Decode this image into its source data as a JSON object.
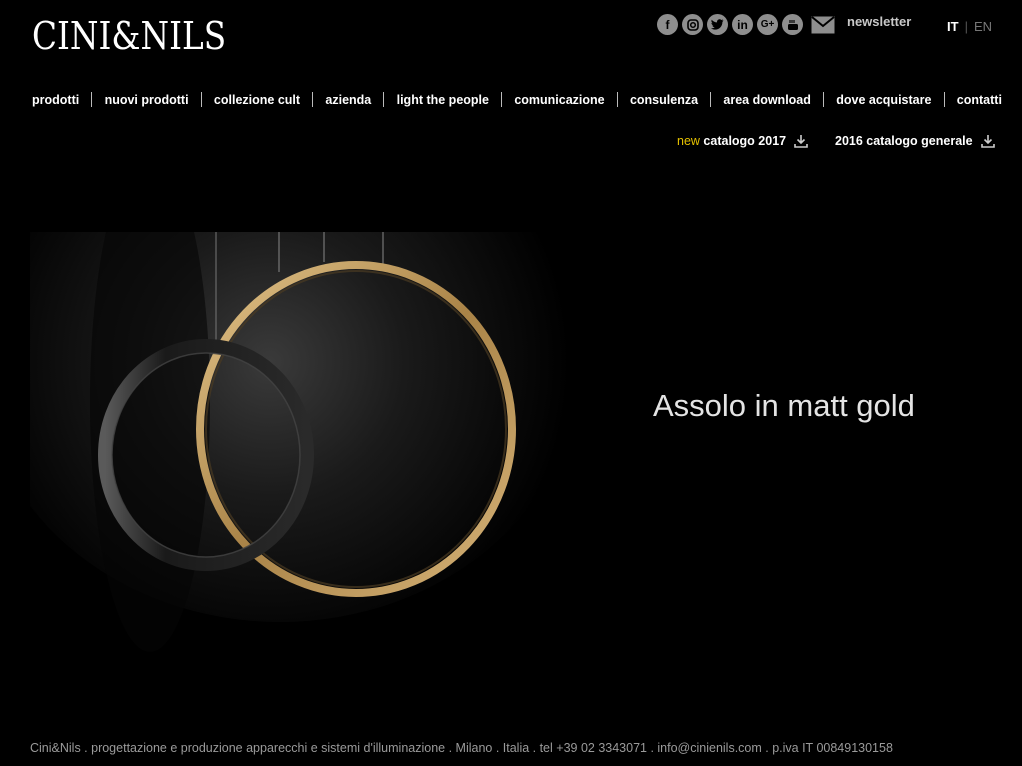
{
  "header": {
    "logo_text": "CINI&NILS",
    "social": [
      {
        "icon": "facebook-icon",
        "glyph": "f"
      },
      {
        "icon": "instagram-icon",
        "glyph": "◎"
      },
      {
        "icon": "twitter-icon",
        "glyph": "t"
      },
      {
        "icon": "linkedin-icon",
        "glyph": "in"
      },
      {
        "icon": "google-plus-icon",
        "glyph": "G+"
      },
      {
        "icon": "youtube-icon",
        "glyph": "▶"
      }
    ],
    "newsletter_label": "newsletter",
    "lang": {
      "it": "IT",
      "sep": "|",
      "en": "EN"
    }
  },
  "nav": {
    "items": [
      "prodotti",
      "nuovi prodotti",
      "collezione cult",
      "azienda",
      "light the people",
      "comunicazione",
      "consulenza",
      "area download",
      "dove acquistare",
      "contatti"
    ]
  },
  "catalogs": {
    "c1_prefix": "new",
    "c1_label": "catalogo 2017",
    "c2_label": "2016 catalogo generale"
  },
  "hero": {
    "caption": "Assolo in matt gold"
  },
  "footer": {
    "text": "Cini&Nils . progettazione e produzione apparecchi e sistemi d'illuminazione . Milano . Italia . tel +39 02 3343071 . info@cinienils.com . p.iva IT 00849130158"
  },
  "colors": {
    "background": "#000000",
    "accent_new": "#e6c200",
    "ring_gold": "#c9a56a"
  }
}
